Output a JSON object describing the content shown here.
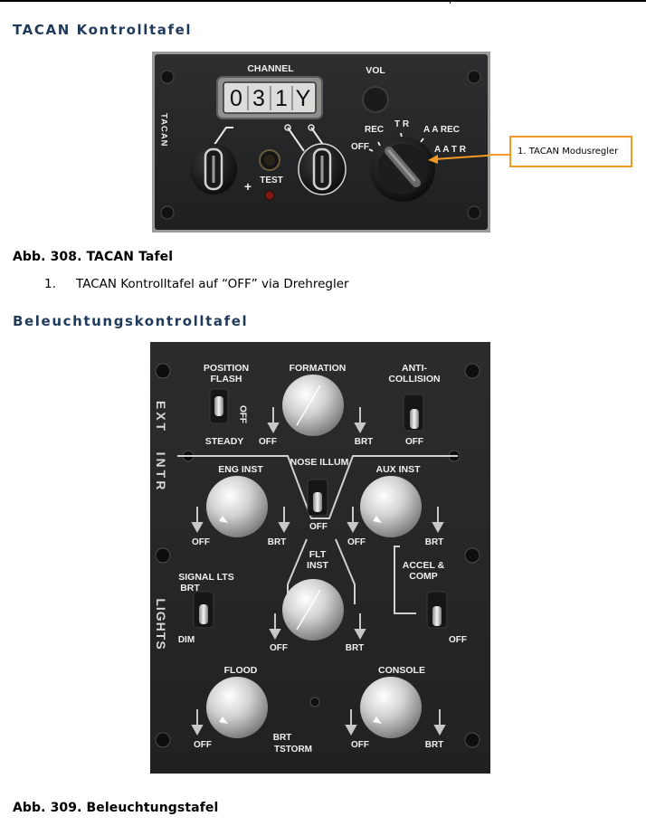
{
  "sections": [
    {
      "heading": "TACAN Kontrolltafel",
      "figure": {
        "channel_label": "CHANNEL",
        "channel_digits": [
          "0",
          "3",
          "1",
          "Y"
        ],
        "vol_label": "VOL",
        "side_label": "TACAN",
        "test_label": "TEST",
        "plus_label": "+",
        "mode_labels": {
          "off": "OFF",
          "rec": "REC",
          "tr": "T R",
          "aarec": "A A REC",
          "aatr": "A A T R"
        },
        "callout": "1. TACAN Modusregler"
      },
      "caption": "Abb. 308. TACAN Tafel",
      "list": [
        {
          "num": "1.",
          "text": "TACAN Kontrolltafel auf “OFF” via Drehregler"
        }
      ]
    },
    {
      "heading": "Beleuchtungskontrolltafel",
      "figure": {
        "side_ext": "EXT",
        "side_intr": "INTR",
        "side_lights": "LIGHTS",
        "position_flash": "POSITION\nFLASH",
        "position_off": "OFF",
        "steady": "STEADY",
        "formation": "FORMATION",
        "anti_collision": "ANTI-\nCOLLISION",
        "eng_inst": "ENG INST",
        "nose_illum": "NOSE ILLUM",
        "aux_inst": "AUX INST",
        "flt_inst": "FLT\nINST",
        "signal_lts": "SIGNAL LTS\nBRT",
        "dim": "DIM",
        "accel_comp": "ACCEL &\nCOMP",
        "flood": "FLOOD",
        "console": "CONSOLE",
        "off": "OFF",
        "brt": "BRT",
        "tstorm": "TSTORM"
      },
      "caption": "Abb. 309. Beleuchtungstafel"
    }
  ]
}
